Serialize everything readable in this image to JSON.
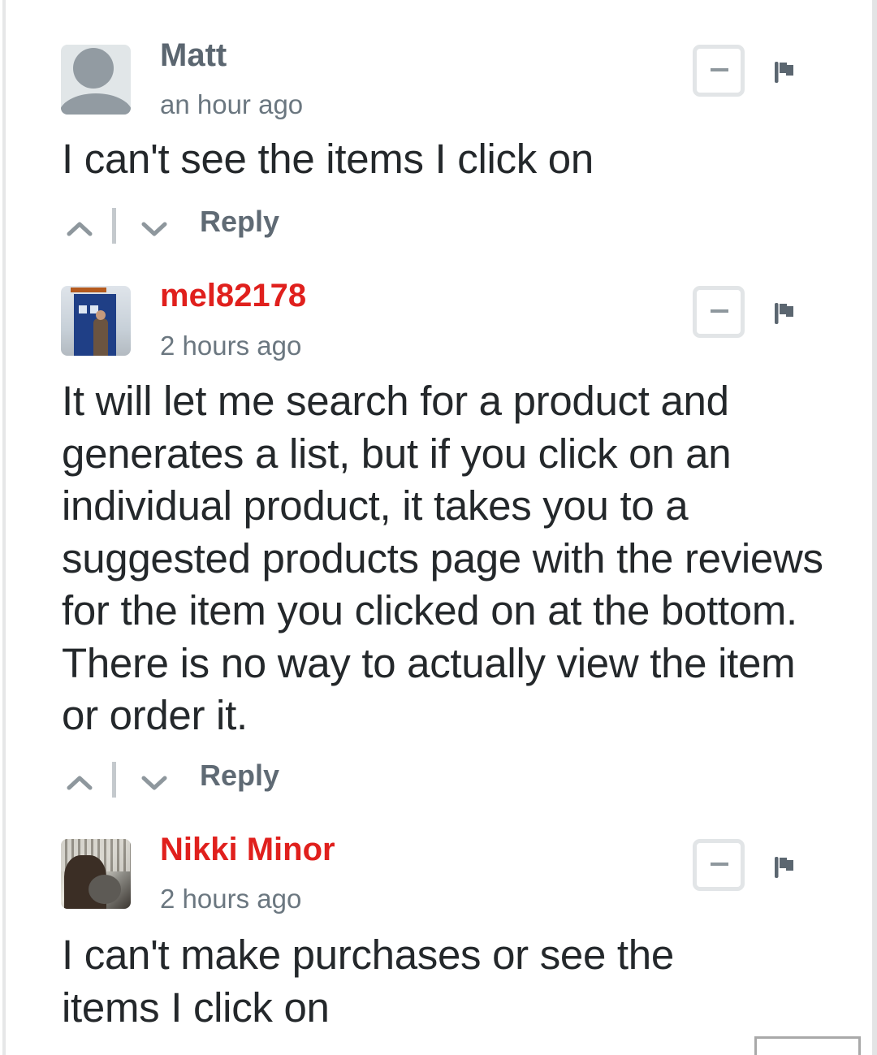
{
  "colors": {
    "username_default": "#5b6670",
    "username_highlight": "#e0201d",
    "timestamp": "#6b7780",
    "body_text": "#24282b",
    "reply": "#5f6a74",
    "icon_gray": "#8e979d",
    "flag": "#5b6670"
  },
  "comments": [
    {
      "username": "Matt",
      "username_style": "default",
      "avatar": "default-avatar-icon",
      "timestamp": "an hour ago",
      "body": "I can't see the items I click on",
      "actions": {
        "upvote": "chevron-up-icon",
        "downvote": "chevron-down-icon",
        "reply_label": "Reply"
      },
      "collapse_icon": "minus-icon",
      "flag_icon": "flag-icon"
    },
    {
      "username": "mel82178",
      "username_style": "highlight",
      "avatar": "tardis-photo-avatar",
      "timestamp": "2 hours ago",
      "body": "It will let me search for a product and generates a list, but if you click on an individual product, it takes you to a suggested products page with the reviews for the item you clicked on at the bottom. There is no way to actually view the item or order it.",
      "actions": {
        "upvote": "chevron-up-icon",
        "downvote": "chevron-down-icon",
        "reply_label": "Reply"
      },
      "collapse_icon": "minus-icon",
      "flag_icon": "flag-icon"
    },
    {
      "username": "Nikki Minor",
      "username_style": "highlight",
      "avatar": "user-photo-avatar",
      "timestamp": "2 hours ago",
      "body": "I can't make purchases or see the items I click on",
      "collapse_icon": "minus-icon",
      "flag_icon": "flag-icon"
    }
  ]
}
